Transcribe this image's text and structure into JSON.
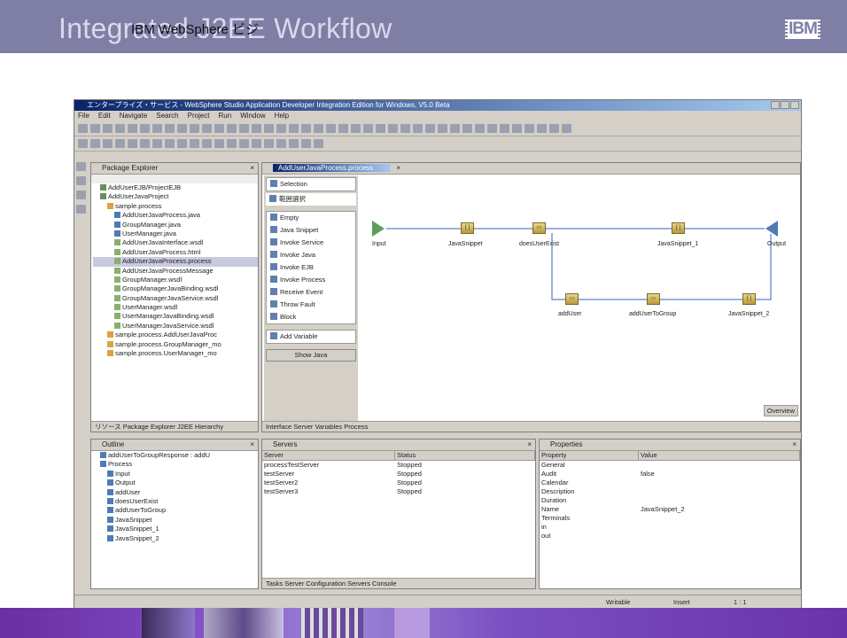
{
  "slide": {
    "title": "Integrated J2EE Workflow",
    "subtitle": "IBM WebSphere ビジ",
    "logo": "IBM"
  },
  "window": {
    "title": "エンタープライズ・サービス - WebSphere Studio Application Developer Integration Edition for Windows, V5.0 Beta",
    "menu": [
      "File",
      "Edit",
      "Navigate",
      "Search",
      "Project",
      "Run",
      "Window",
      "Help"
    ]
  },
  "package_explorer": {
    "title": "Package Explorer",
    "items": [
      {
        "label": "AddUserEJB/ProjectEJB",
        "indent": 1,
        "icon": "project"
      },
      {
        "label": "AddUserJavaProject",
        "indent": 1,
        "icon": "project"
      },
      {
        "label": "sample.process",
        "indent": 2,
        "icon": "package"
      },
      {
        "label": "AddUserJavaProcess.java",
        "indent": 3,
        "icon": "java"
      },
      {
        "label": "GroupManager.java",
        "indent": 3,
        "icon": "java"
      },
      {
        "label": "UserManager.java",
        "indent": 3,
        "icon": "java"
      },
      {
        "label": "AddUserJavaInterface.wsdl",
        "indent": 3,
        "icon": "wsdl"
      },
      {
        "label": "AddUserJavaProcess.html",
        "indent": 3,
        "icon": "wsdl"
      },
      {
        "label": "AddUserJavaProcess.process",
        "indent": 3,
        "icon": "wsdl",
        "selected": true
      },
      {
        "label": "AddUserJavaProcessMessage",
        "indent": 3,
        "icon": "wsdl"
      },
      {
        "label": "GroupManager.wsdl",
        "indent": 3,
        "icon": "wsdl"
      },
      {
        "label": "GroupManagerJavaBinding.wsdl",
        "indent": 3,
        "icon": "wsdl"
      },
      {
        "label": "GroupManagerJavaService.wsdl",
        "indent": 3,
        "icon": "wsdl"
      },
      {
        "label": "UserManager.wsdl",
        "indent": 3,
        "icon": "wsdl"
      },
      {
        "label": "UserManagerJavaBinding.wsdl",
        "indent": 3,
        "icon": "wsdl"
      },
      {
        "label": "UserManagerJavaService.wsdl",
        "indent": 3,
        "icon": "wsdl"
      },
      {
        "label": "sample.process.AddUserJavaProc",
        "indent": 2,
        "icon": "package"
      },
      {
        "label": "sample.process.GroupManager_mo",
        "indent": 2,
        "icon": "package"
      },
      {
        "label": "sample.process.UserManager_mo",
        "indent": 2,
        "icon": "package"
      }
    ],
    "tabs": "リソース  Package Explorer  J2EE Hierarchy"
  },
  "editor": {
    "tab": "AddUserJavaProcess.process",
    "palette": {
      "selection": "Selection",
      "marquee": "範囲選択",
      "items": [
        "Empty",
        "Java Snippet",
        "Invoke Service",
        "Invoke Java",
        "Invoke EJB",
        "Invoke Process",
        "Receive Event",
        "Throw Fault",
        "Block"
      ],
      "variables": "Add Variable",
      "show_java": "Show Java"
    },
    "nodes": {
      "input": "Input",
      "javasnippet": "JavaSnippet",
      "doesuserexist": "doesUserExist",
      "javasnippet1": "JavaSnippet_1",
      "output": "Output",
      "adduser": "addUser",
      "addusertogroup": "addUserToGroup",
      "javasnippet2": "JavaSnippet_2"
    },
    "overview": "Overview",
    "bottom_tabs": "Interface  Server  Variables  Process"
  },
  "outline": {
    "title": "Outline",
    "items": [
      {
        "label": "addUserToGroupResponse : addU",
        "indent": 1
      },
      {
        "label": "Process",
        "indent": 1
      },
      {
        "label": "Input",
        "indent": 2
      },
      {
        "label": "Output",
        "indent": 2
      },
      {
        "label": "addUser",
        "indent": 2
      },
      {
        "label": "doesUserExist",
        "indent": 2
      },
      {
        "label": "addUserToGroup",
        "indent": 2
      },
      {
        "label": "JavaSnippet",
        "indent": 2
      },
      {
        "label": "JavaSnippet_1",
        "indent": 2
      },
      {
        "label": "JavaSnippet_2",
        "indent": 2
      }
    ]
  },
  "servers": {
    "title": "Servers",
    "columns": [
      "Server",
      "Status"
    ],
    "rows": [
      [
        "processTestServer",
        "Stopped"
      ],
      [
        "testServer",
        "Stopped"
      ],
      [
        "testServer2",
        "Stopped"
      ],
      [
        "testServer3",
        "Stopped"
      ]
    ],
    "tabs": "Tasks  Server Configuration  Servers  Console"
  },
  "properties": {
    "title": "Properties",
    "columns": [
      "Property",
      "Value"
    ],
    "rows": [
      [
        "General",
        ""
      ],
      [
        "Audit",
        "false"
      ],
      [
        "Calendar",
        ""
      ],
      [
        "Description",
        ""
      ],
      [
        "Duration",
        ""
      ],
      [
        "Name",
        "JavaSnippet_2"
      ],
      [
        "Terminals",
        ""
      ],
      [
        "in",
        ""
      ],
      [
        "out",
        ""
      ]
    ]
  },
  "statusbar": {
    "writable": "Writable",
    "insert": "Insert",
    "position": "1 : 1"
  }
}
